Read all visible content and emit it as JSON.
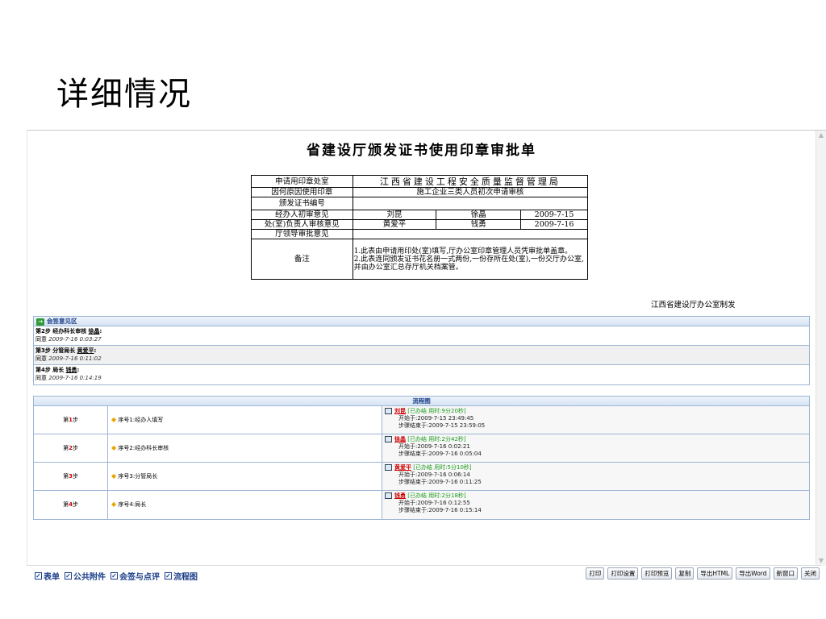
{
  "slide": {
    "title": "详细情况"
  },
  "document": {
    "title": "省建设厅颁发证书使用印章审批单",
    "rows": {
      "applicant_label": "申请用印章处室",
      "applicant_value": "江西省建设工程安全质量监督管理局",
      "reason_label": "因何原因使用印章",
      "reason_value": "施工企业三类人员初次申请审核",
      "cert_no_label": "颁发证书编号",
      "cert_no_value": "",
      "handler_label": "经办人初审意见",
      "handler_name1": "刘昆",
      "handler_name2": "徐晶",
      "handler_date": "2009-7-15",
      "office_label": "处(室)负责人审核意见",
      "office_name1": "黄爱平",
      "office_name2": "钱勇",
      "office_date": "2009-7-16",
      "leader_label": "厅领导审批意见",
      "leader_value": "",
      "notes_label": "备注",
      "notes_1": "1.此表由申请用印处(室)填写,厅办公室印章管理人员凭审批单盖章。",
      "notes_2": "2.此表连同颁发证书花名册一式两份,一份存所在处(室),一份交厅办公室,并由办公室汇总存厅机关档案管。"
    },
    "issuer": "江西省建设厅办公室制发"
  },
  "signatures": {
    "header": "会签意见区",
    "items": [
      {
        "step": "第2步 经办科长审核",
        "name": "徐晶",
        "opinion": "同意",
        "time": "2009-7-16 0:03:27"
      },
      {
        "step": "第3步 分管局长",
        "name": "黄爱平",
        "opinion": "同意",
        "time": "2009-7-16 0:11:02"
      },
      {
        "step": "第4步 局长",
        "name": "钱勇",
        "opinion": "同意",
        "time": "2009-7-16 0:14:19"
      }
    ]
  },
  "flow": {
    "header": "流程图",
    "rows": [
      {
        "step_prefix": "第",
        "step_num": "1",
        "step_suffix": "步",
        "node": "序号1:经办人填写",
        "who": "刘昆",
        "status": "[已办结 用时:9分20秒]",
        "start": "开始于:2009-7-15 23:49:45",
        "end": "步骤结束于:2009-7-15 23:59:05"
      },
      {
        "step_prefix": "第",
        "step_num": "2",
        "step_suffix": "步",
        "node": "序号2:经办科长审核",
        "who": "徐晶",
        "status": "[已办结 用时:2分42秒]",
        "start": "开始于:2009-7-16 0:02:21",
        "end": "步骤结束于:2009-7-16 0:05:04"
      },
      {
        "step_prefix": "第",
        "step_num": "3",
        "step_suffix": "步",
        "node": "序号3:分管局长",
        "who": "黄爱平",
        "status": "[已办结 用时:5分10秒]",
        "start": "开始于:2009-7-16 0:06:14",
        "end": "步骤结束于:2009-7-16 0:11:25"
      },
      {
        "step_prefix": "第",
        "step_num": "4",
        "step_suffix": "步",
        "node": "序号4:局长",
        "who": "钱勇",
        "status": "[已办结 用时:2分18秒]",
        "start": "开始于:2009-7-16 0:12:55",
        "end": "步骤结束于:2009-7-16 0:15:14"
      }
    ]
  },
  "toolbar": {
    "checks": [
      "表单",
      "公共附件",
      "会签与点评",
      "流程图"
    ],
    "check_mark": "✓",
    "buttons": [
      "打印",
      "打印设置",
      "打印预览",
      "复制",
      "导出HTML",
      "导出Word",
      "新窗口",
      "关闭"
    ]
  },
  "icons": {
    "scroll_up": "▲",
    "scroll_down": "▼",
    "go_icon": "→",
    "diamond_icon": "◆"
  }
}
